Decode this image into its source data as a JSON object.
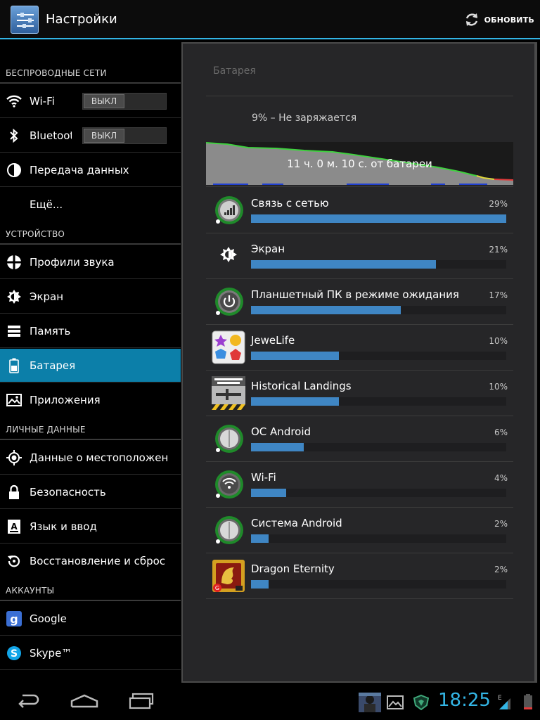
{
  "app": {
    "title": "Настройки",
    "refresh_label": "ОБНОВИТЬ",
    "accent": "#33b5e5"
  },
  "sidebar": {
    "sections": [
      {
        "header": "БЕСПРОВОДНЫЕ СЕТИ"
      },
      {
        "header": "УСТРОЙСТВО"
      },
      {
        "header": "ЛИЧНЫЕ ДАННЫЕ"
      },
      {
        "header": "АККАУНТЫ"
      }
    ],
    "items": [
      {
        "label": "Wi-Fi",
        "icon": "wifi-icon",
        "toggle": "ВЫКЛ"
      },
      {
        "label": "Bluetooth",
        "icon": "bluetooth-icon",
        "toggle": "ВЫКЛ"
      },
      {
        "label": "Передача данных",
        "icon": "data-usage-icon"
      },
      {
        "label": "Ещё..."
      },
      {
        "label": "Профили звука",
        "icon": "sound-icon"
      },
      {
        "label": "Экран",
        "icon": "display-icon"
      },
      {
        "label": "Память",
        "icon": "storage-icon"
      },
      {
        "label": "Батарея",
        "icon": "battery-icon",
        "active": true
      },
      {
        "label": "Приложения",
        "icon": "apps-icon"
      },
      {
        "label": "Данные о местоположении",
        "icon": "location-icon"
      },
      {
        "label": "Безопасность",
        "icon": "lock-icon"
      },
      {
        "label": "Язык и ввод",
        "icon": "language-icon"
      },
      {
        "label": "Восстановление и сброс",
        "icon": "restore-icon"
      },
      {
        "label": "Google",
        "icon": "google-icon"
      },
      {
        "label": "Skype™",
        "icon": "skype-icon"
      }
    ]
  },
  "battery": {
    "title": "Батарея",
    "status": "9% – Не заряжается",
    "graph_text": "11 ч. 0 м. 10 с. от батареи",
    "usage": [
      {
        "name": "Связь с сетью",
        "percent": "29%",
        "value": 29,
        "icon": "cell-signal-icon"
      },
      {
        "name": "Экран",
        "percent": "21%",
        "value": 21,
        "icon": "brightness-icon"
      },
      {
        "name": "Планшетный ПК в режиме ожидания",
        "percent": "17%",
        "value": 17,
        "icon": "power-icon"
      },
      {
        "name": "JeweLife",
        "percent": "10%",
        "value": 10,
        "icon": "jewelife-app-icon"
      },
      {
        "name": "Historical Landings",
        "percent": "10%",
        "value": 10,
        "icon": "historical-landings-app-icon"
      },
      {
        "name": "ОС Android",
        "percent": "6%",
        "value": 6,
        "icon": "android-os-icon"
      },
      {
        "name": "Wi-Fi",
        "percent": "4%",
        "value": 4,
        "icon": "wifi-icon"
      },
      {
        "name": "Система Android",
        "percent": "2%",
        "value": 2,
        "icon": "android-system-icon"
      },
      {
        "name": "Dragon Eternity",
        "percent": "2%",
        "value": 2,
        "icon": "dragon-eternity-app-icon"
      }
    ]
  },
  "statusbar": {
    "time": "18:25"
  }
}
